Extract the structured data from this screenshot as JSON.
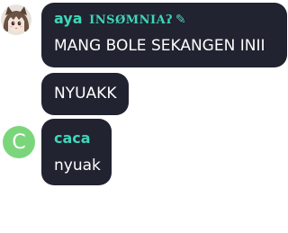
{
  "colors": {
    "bubble": "#212330",
    "message_text": "#ffffff",
    "username_teal": "#3fd6ba",
    "caca_avatar": "#7bd67b"
  },
  "messages": [
    {
      "author": "aya",
      "author_flair": "INSØMNIAʔ",
      "edit_icon": "pencil-icon",
      "avatar": "anime-girl-avatar",
      "text": "MANG BOLE SEKANGEN INII"
    },
    {
      "author": "",
      "text": "NYUAKK"
    },
    {
      "author": "caca",
      "avatar_letter": "C",
      "text": "nyuak"
    }
  ]
}
